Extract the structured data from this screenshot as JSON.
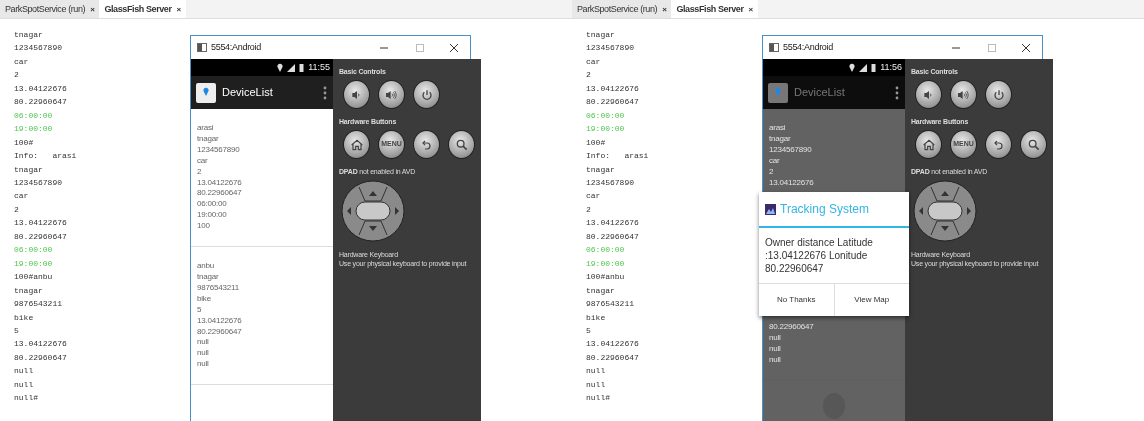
{
  "panels": [
    {
      "tabs": [
        {
          "label": "ParkSpotService (run)",
          "close": "×",
          "selected": false
        },
        {
          "label": "GlassFish Server",
          "close": "×",
          "selected": true
        }
      ],
      "console": [
        {
          "text": "tnagar",
          "kind": "text"
        },
        {
          "text": "1234567890",
          "kind": "text"
        },
        {
          "text": "car",
          "kind": "text"
        },
        {
          "text": "2",
          "kind": "text"
        },
        {
          "text": "13.04122676",
          "kind": "text"
        },
        {
          "text": "80.22960647",
          "kind": "text"
        },
        {
          "text": "06:00:00",
          "kind": "time"
        },
        {
          "text": "19:00:00",
          "kind": "time"
        },
        {
          "text": "100#",
          "kind": "text"
        },
        {
          "text": "Info:   arasi",
          "kind": "text"
        },
        {
          "text": "tnagar",
          "kind": "text"
        },
        {
          "text": "1234567890",
          "kind": "text"
        },
        {
          "text": "car",
          "kind": "text"
        },
        {
          "text": "2",
          "kind": "text"
        },
        {
          "text": "13.04122676",
          "kind": "text"
        },
        {
          "text": "80.22960647",
          "kind": "text"
        },
        {
          "text": "06:00:00",
          "kind": "time"
        },
        {
          "text": "19:00:00",
          "kind": "time"
        },
        {
          "text": "100#anbu",
          "kind": "text"
        },
        {
          "text": "tnagar",
          "kind": "text"
        },
        {
          "text": "9876543211",
          "kind": "text"
        },
        {
          "text": "bike",
          "kind": "text"
        },
        {
          "text": "5",
          "kind": "text"
        },
        {
          "text": "13.04122676",
          "kind": "text"
        },
        {
          "text": "80.22960647",
          "kind": "text"
        },
        {
          "text": "null",
          "kind": "text"
        },
        {
          "text": "null",
          "kind": "text"
        },
        {
          "text": "null#",
          "kind": "text"
        }
      ],
      "emulator": {
        "title": "5554:Android",
        "clock": "11:55",
        "app_title": "DeviceList",
        "dimmed": false,
        "list": [
          {
            "lines": [
              "arasi",
              "tnagar",
              "1234567890",
              "car",
              "2",
              "13.04122676",
              "80.22960647",
              "06:00:00",
              "19:00:00",
              "100"
            ]
          },
          {
            "lines": [
              "anbu",
              "tnagar",
              "9876543211",
              "bike",
              "5",
              "13.04122676",
              "80.22960647",
              "null",
              "null",
              "null"
            ]
          }
        ],
        "controls": {
          "basic_heading": "Basic Controls",
          "basic_buttons": [
            {
              "kind": "volume-down"
            },
            {
              "kind": "volume-up"
            },
            {
              "kind": "power"
            }
          ],
          "hardware_heading": "Hardware Buttons",
          "hardware_buttons": [
            {
              "kind": "home"
            },
            {
              "kind": "menu",
              "label": "MENU"
            },
            {
              "kind": "back"
            },
            {
              "kind": "search"
            }
          ],
          "dpad_heading": "**DPAD** not enabled in AVD",
          "keyboard_heading": "Hardware Keyboard",
          "keyboard_text": "Use your physical keyboard to provide input"
        }
      }
    },
    {
      "tabs": [
        {
          "label": "ParkSpotService (run)",
          "close": "×",
          "selected": false
        },
        {
          "label": "GlassFish Server",
          "close": "×",
          "selected": true
        }
      ],
      "console": [
        {
          "text": "tnagar",
          "kind": "text"
        },
        {
          "text": "1234567890",
          "kind": "text"
        },
        {
          "text": "car",
          "kind": "text"
        },
        {
          "text": "2",
          "kind": "text"
        },
        {
          "text": "13.04122676",
          "kind": "text"
        },
        {
          "text": "80.22960647",
          "kind": "text"
        },
        {
          "text": "06:00:00",
          "kind": "time"
        },
        {
          "text": "19:00:00",
          "kind": "time"
        },
        {
          "text": "100#",
          "kind": "text"
        },
        {
          "text": "Info:   arasi",
          "kind": "text"
        },
        {
          "text": "tnagar",
          "kind": "text"
        },
        {
          "text": "1234567890",
          "kind": "text"
        },
        {
          "text": "car",
          "kind": "text"
        },
        {
          "text": "2",
          "kind": "text"
        },
        {
          "text": "13.04122676",
          "kind": "text"
        },
        {
          "text": "80.22960647",
          "kind": "text"
        },
        {
          "text": "06:00:00",
          "kind": "time"
        },
        {
          "text": "19:00:00",
          "kind": "time"
        },
        {
          "text": "100#anbu",
          "kind": "text"
        },
        {
          "text": "tnagar",
          "kind": "text"
        },
        {
          "text": "9876543211",
          "kind": "text"
        },
        {
          "text": "bike",
          "kind": "text"
        },
        {
          "text": "5",
          "kind": "text"
        },
        {
          "text": "13.04122676",
          "kind": "text"
        },
        {
          "text": "80.22960647",
          "kind": "text"
        },
        {
          "text": "null",
          "kind": "text"
        },
        {
          "text": "null",
          "kind": "text"
        },
        {
          "text": "null#",
          "kind": "text"
        }
      ],
      "emulator": {
        "title": "5554:Android",
        "clock": "11:56",
        "app_title": "DeviceList",
        "dimmed": true,
        "touch_shown": true,
        "list": [
          {
            "lines": [
              "arasi",
              "tnagar",
              "1234567890",
              "car",
              "2",
              "13.04122676"
            ]
          },
          {
            "lines": [
              "80.22960647",
              "null",
              "null",
              "null"
            ]
          }
        ],
        "dialog": {
          "title": "Tracking System",
          "message": "Owner distance  Latitude :13.04122676 Lonitude 80.22960647",
          "buttons": [
            "No Thanks",
            "View Map"
          ]
        },
        "controls": {
          "basic_heading": "Basic Controls",
          "basic_buttons": [
            {
              "kind": "volume-down"
            },
            {
              "kind": "volume-up"
            },
            {
              "kind": "power"
            }
          ],
          "hardware_heading": "Hardware Buttons",
          "hardware_buttons": [
            {
              "kind": "home"
            },
            {
              "kind": "menu",
              "label": "MENU"
            },
            {
              "kind": "back"
            },
            {
              "kind": "search"
            }
          ],
          "dpad_heading": "**DPAD** not enabled in AVD",
          "keyboard_heading": "Hardware Keyboard",
          "keyboard_text": "Use your physical keyboard to provide input"
        }
      }
    }
  ]
}
